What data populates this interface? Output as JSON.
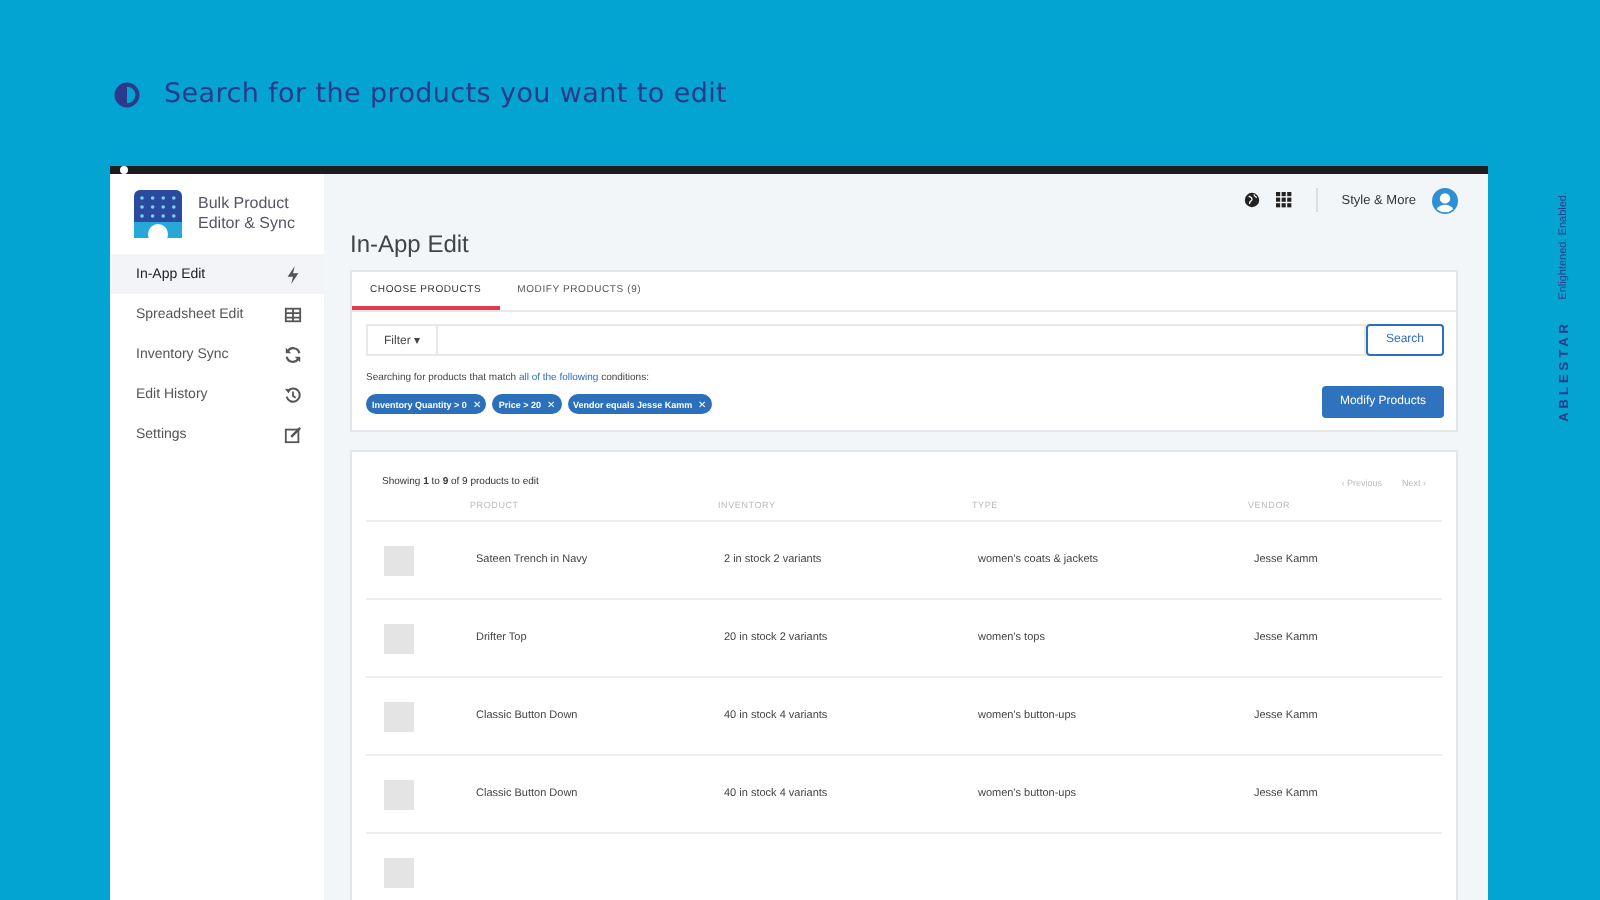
{
  "headline": "Search for the products you want to edit",
  "brand": {
    "name": "ABLESTAR",
    "tagline": "Enlightened. Enabled."
  },
  "app": {
    "name": "Bulk Product Editor & Sync"
  },
  "sidebar": {
    "items": [
      {
        "label": "In-App Edit",
        "selected": true
      },
      {
        "label": "Spreadsheet Edit",
        "selected": false
      },
      {
        "label": "Inventory Sync",
        "selected": false
      },
      {
        "label": "Edit History",
        "selected": false
      },
      {
        "label": "Settings",
        "selected": false
      }
    ]
  },
  "topbar": {
    "store": "Style & More"
  },
  "page_title": "In-App Edit",
  "tabs": [
    {
      "label": "CHOOSE PRODUCTS",
      "selected": true
    },
    {
      "label": "MODIFY PRODUCTS (9)",
      "selected": false
    }
  ],
  "filter": {
    "button": "Filter",
    "caret": "▾",
    "search_button": "Search",
    "description_before": "Searching for products that match",
    "description_link": "all of the following",
    "description_after": "conditions:",
    "chips": [
      "Inventory Quantity > 0",
      "Price > 20",
      "Vendor equals Jesse Kamm"
    ],
    "chip_remove": "✕",
    "action": "Modify Products"
  },
  "results": {
    "summary": "Showing **1** to **9** of 9 products to edit",
    "previous": "‹ Previous",
    "next": "Next ›",
    "columns": [
      "PRODUCT",
      "INVENTORY",
      "TYPE",
      "VENDOR"
    ],
    "rows": [
      {
        "product": "Sateen Trench in Navy",
        "inventory": "2 in stock 2 variants",
        "type": "women's coats & jackets",
        "vendor": "Jesse Kamm"
      },
      {
        "product": "Drifter Top",
        "inventory": "20 in stock 2 variants",
        "type": "women's tops",
        "vendor": "Jesse Kamm"
      },
      {
        "product": "Classic Button Down",
        "inventory": "40 in stock 4 variants",
        "type": "women's button-ups",
        "vendor": "Jesse Kamm"
      },
      {
        "product": "Classic Button Down",
        "inventory": "40 in stock 4 variants",
        "type": "women's button-ups",
        "vendor": "Jesse Kamm"
      }
    ],
    "partial_row": true
  }
}
